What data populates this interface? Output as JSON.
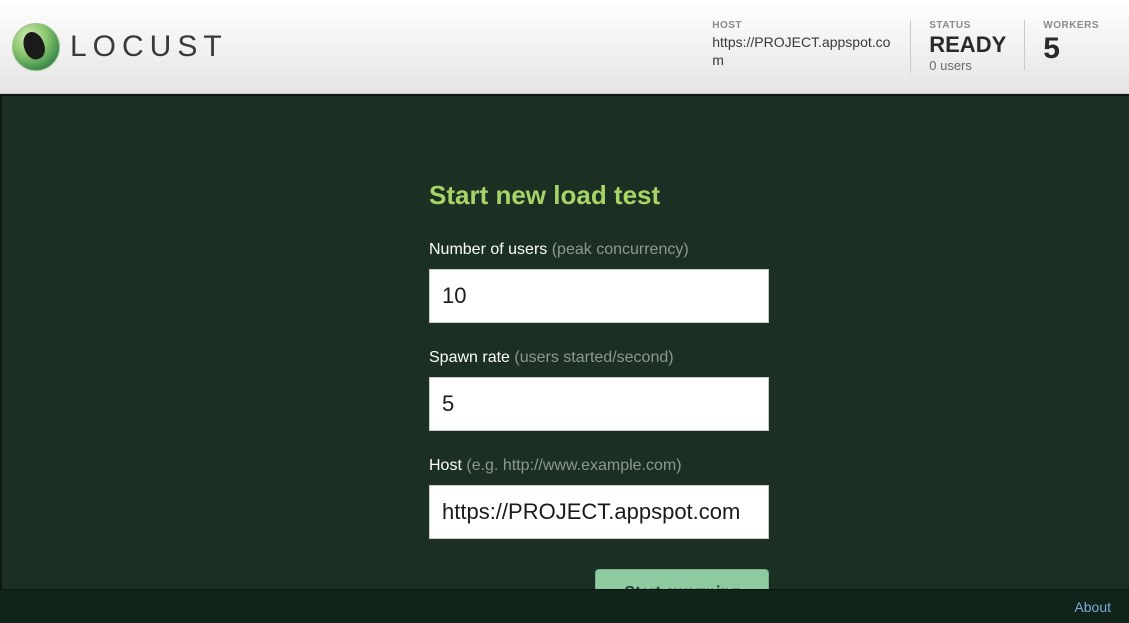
{
  "brand": "LOCUST",
  "header": {
    "host_label": "HOST",
    "host_value": "https://PROJECT.appspot.com",
    "status_label": "STATUS",
    "status_value": "READY",
    "status_sub": "0 users",
    "workers_label": "WORKERS",
    "workers_value": "5"
  },
  "form": {
    "title": "Start new load test",
    "users_label": "Number of users",
    "users_hint": "(peak concurrency)",
    "users_value": "10",
    "spawn_label": "Spawn rate",
    "spawn_hint": "(users started/second)",
    "spawn_value": "5",
    "host_label": "Host",
    "host_hint": "(e.g. http://www.example.com)",
    "host_value": "https://PROJECT.appspot.com",
    "submit": "Start swarming"
  },
  "footer": {
    "about": "About"
  }
}
